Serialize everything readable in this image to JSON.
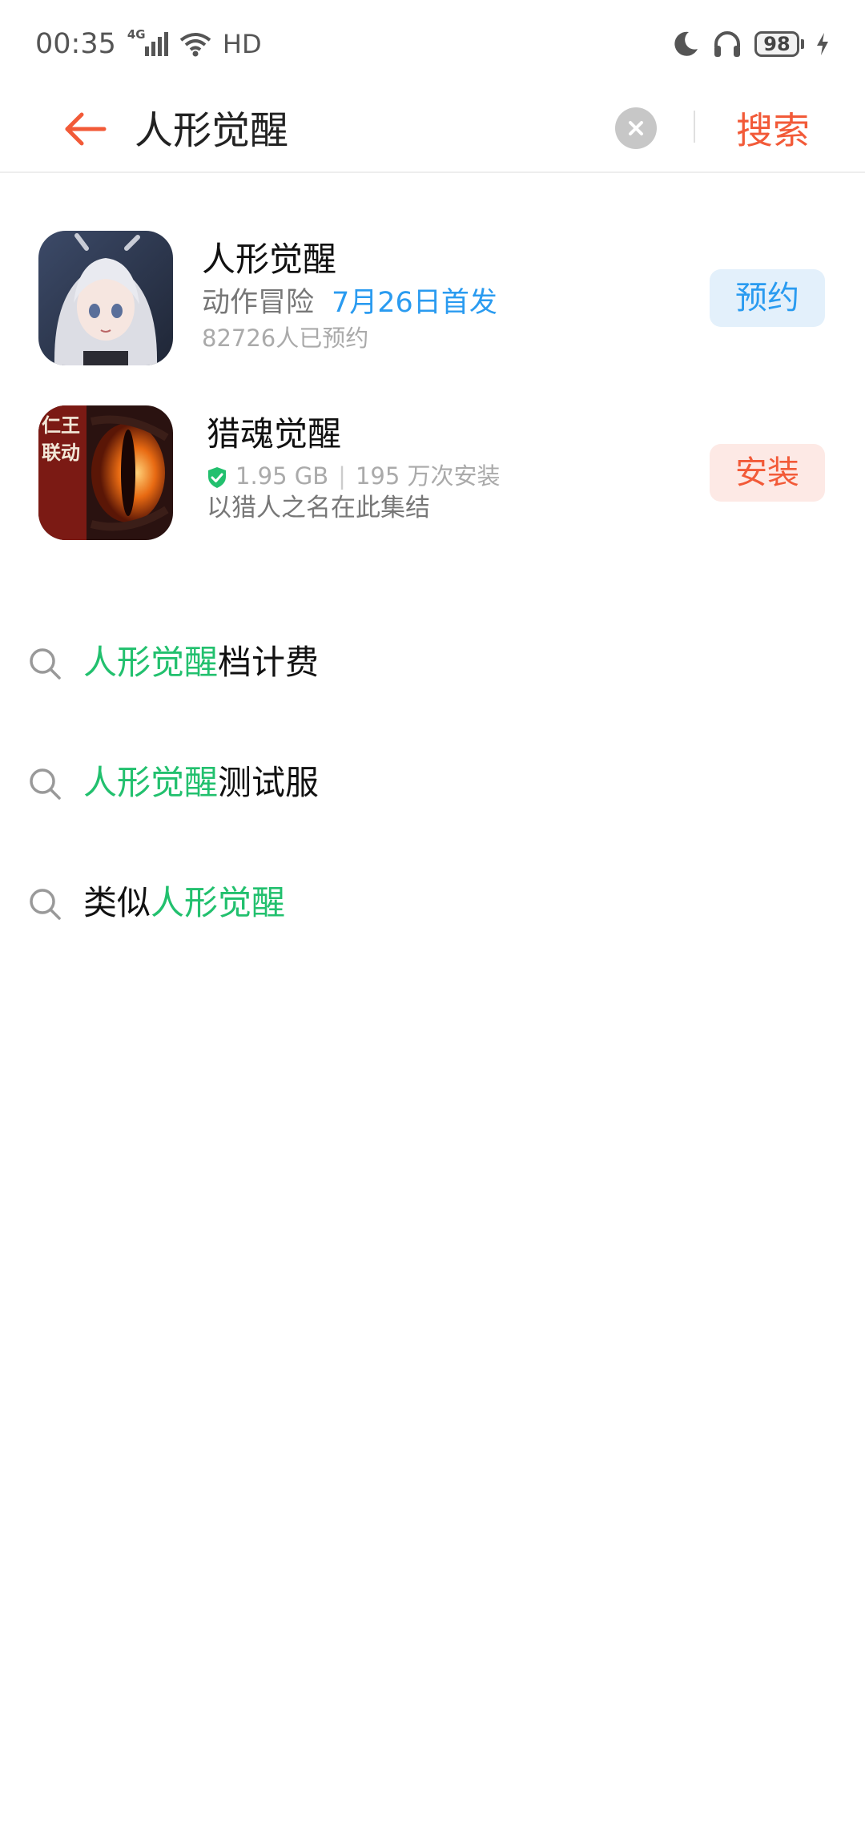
{
  "status_bar": {
    "time": "00:35",
    "network": "4G",
    "hd": "HD",
    "battery": "98"
  },
  "search": {
    "query": "人形觉醒",
    "search_label": "搜索"
  },
  "apps": [
    {
      "name": "人形觉醒",
      "category": "动作冒险",
      "release": "7月26日首发",
      "reservations": "82726人已预约",
      "button": "预约"
    },
    {
      "name": "猎魂觉醒",
      "size": "1.95 GB",
      "installs": "195 万次安装",
      "description": "以猎人之名在此集结",
      "icon_text": "仁王联动",
      "button": "安装"
    }
  ],
  "suggestions": [
    {
      "highlight": "人形觉醒",
      "suffix": "档计费"
    },
    {
      "highlight": "人形觉醒",
      "suffix": "测试服"
    },
    {
      "prefix": "类似",
      "highlight": "人形觉醒"
    }
  ],
  "colors": {
    "accent": "#f25a38",
    "blue": "#2a9bf0",
    "green": "#22c06e"
  }
}
